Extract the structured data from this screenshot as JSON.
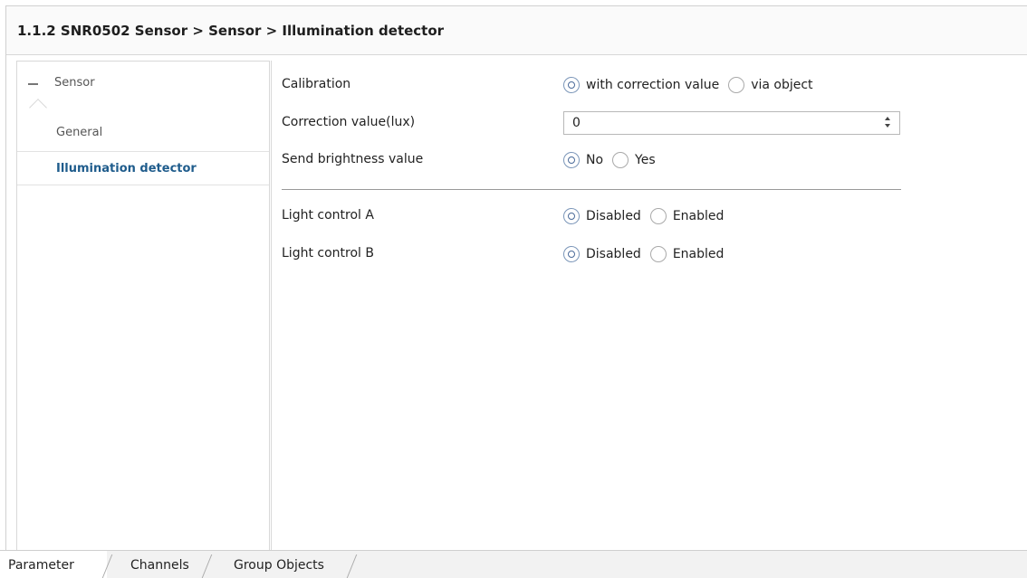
{
  "window": {
    "title": "1.1.2 SNR0502 Sensor > Sensor > Illumination detector"
  },
  "sidebar": {
    "root": {
      "label": "Sensor",
      "icon": "collapse-minus-icon"
    },
    "items": [
      {
        "label": "General",
        "selected": false
      },
      {
        "label": "Illumination detector",
        "selected": true
      }
    ]
  },
  "parameters": {
    "calibration": {
      "label": "Calibration",
      "options": [
        "with correction value",
        "via object"
      ],
      "selected": "with correction value"
    },
    "correction_value": {
      "label": "Correction value(lux)",
      "value": "0"
    },
    "send_brightness": {
      "label": "Send brightness value",
      "options": [
        "No",
        "Yes"
      ],
      "selected": "No"
    },
    "light_control_a": {
      "label": "Light control A",
      "options": [
        "Disabled",
        "Enabled"
      ],
      "selected": "Disabled"
    },
    "light_control_b": {
      "label": "Light control B",
      "options": [
        "Disabled",
        "Enabled"
      ],
      "selected": "Disabled"
    }
  },
  "tabs": [
    {
      "label": "Parameter",
      "active": true
    },
    {
      "label": "Channels",
      "active": false
    },
    {
      "label": "Group Objects",
      "active": false
    }
  ],
  "colors": {
    "selected_item": "#1f5c8c",
    "radio_checked": "#4a6a99"
  }
}
